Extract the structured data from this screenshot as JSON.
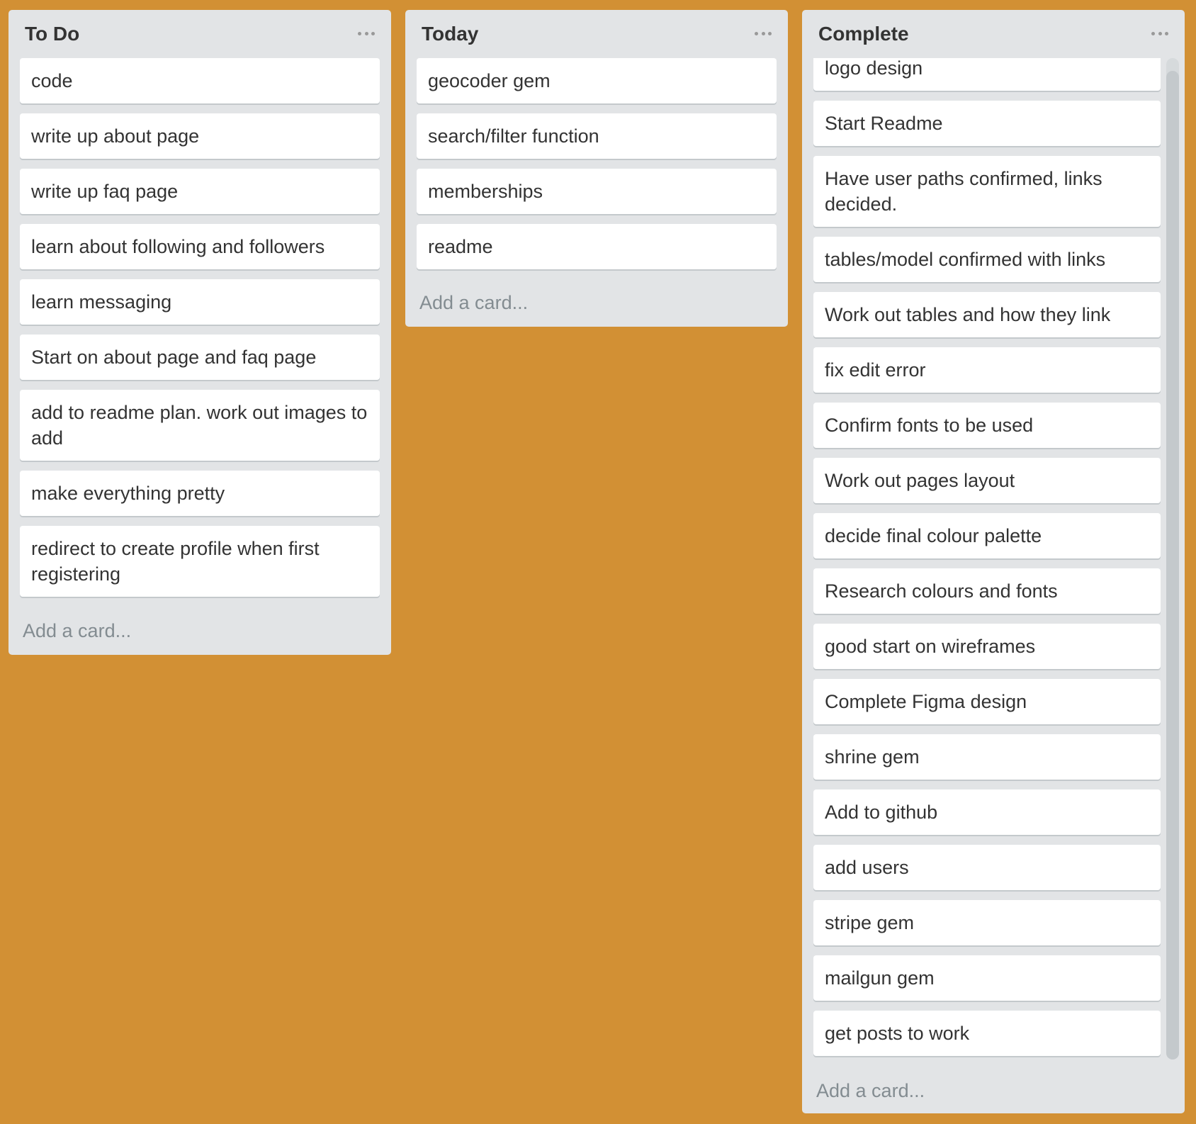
{
  "colors": {
    "board_background": "#d29034",
    "list_background": "#e2e4e6",
    "card_background": "#ffffff",
    "text": "#333333",
    "muted_text": "#838c91"
  },
  "lists": [
    {
      "title": "To Do",
      "menu_icon": "ellipsis-icon",
      "cards": [
        "code",
        "write up about page",
        "write up faq page",
        "learn about following and followers",
        "learn messaging",
        "Start on about page and faq page",
        "add to readme plan. work out images to add",
        "make everything pretty",
        "redirect to create profile when first registering"
      ],
      "add_card_label": "Add a card..."
    },
    {
      "title": "Today",
      "menu_icon": "ellipsis-icon",
      "cards": [
        "geocoder gem",
        "search/filter function",
        "memberships",
        "readme"
      ],
      "add_card_label": "Add a card..."
    },
    {
      "title": "Complete",
      "menu_icon": "ellipsis-icon",
      "cards": [
        "logo design",
        "Start Readme",
        "Have user paths confirmed, links decided.",
        "tables/model confirmed with links",
        "Work out tables and how they link",
        "fix edit error",
        "Confirm fonts to be used",
        "Work out pages layout",
        "decide final colour palette",
        "Research colours and fonts",
        "good start on wireframes",
        "Complete Figma design",
        "shrine gem",
        "Add to github",
        "add users",
        "stripe gem",
        "mailgun gem",
        "get posts to work"
      ],
      "add_card_label": "Add a card..."
    }
  ]
}
